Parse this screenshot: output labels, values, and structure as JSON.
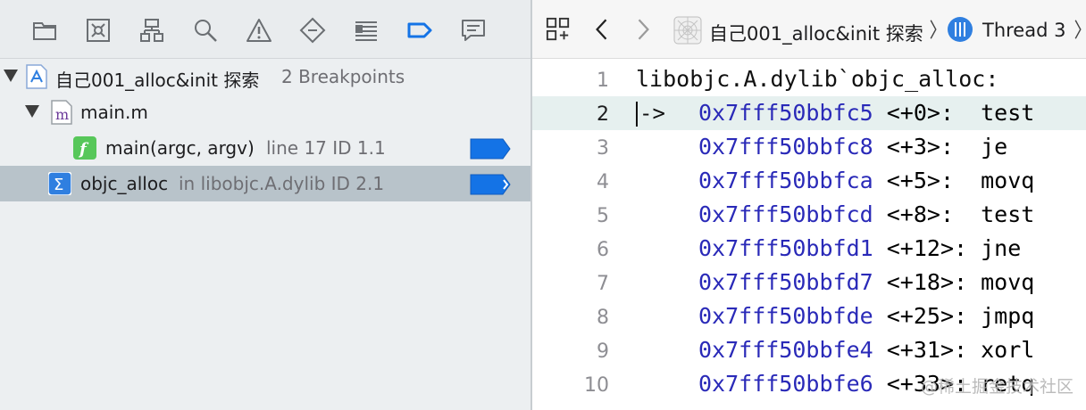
{
  "navigator": {
    "toolbar_icons": [
      "folder-icon",
      "source-control-icon",
      "hierarchy-icon",
      "search-icon",
      "warning-icon",
      "test-diamond-icon",
      "debug-list-icon",
      "breakpoint-icon",
      "report-icon"
    ],
    "active_tab": "breakpoint-icon",
    "project": {
      "name": "自己001_alloc&init 探索",
      "count": "2 Breakpoints"
    },
    "file": {
      "name": "main.m",
      "icon_letter": "m"
    },
    "breakpoints": [
      {
        "symbol": "main(argc, argv)",
        "detail": "line 17 ID 1.1",
        "icon_letter": "f",
        "icon_color": "#57c75a"
      },
      {
        "symbol": "objc_alloc",
        "detail": "in libobjc.A.dylib ID 2.1",
        "icon_letter": "Σ",
        "icon_color": "#2f7fe0"
      }
    ],
    "breakpoint_color": "#1473e6"
  },
  "jumpbar": {
    "project": "自己001_alloc&init 探索",
    "thread": "Thread 3"
  },
  "code": {
    "header": "libobjc.A.dylib`objc_alloc:",
    "current_marker": "->",
    "lines": [
      {
        "num": "1"
      },
      {
        "num": "2",
        "addr": "0x7fff50bbfc5",
        "off": "<+0>:",
        "op": "  test"
      },
      {
        "num": "3",
        "addr": "0x7fff50bbfc8",
        "off": "<+3>:",
        "op": "  je"
      },
      {
        "num": "4",
        "addr": "0x7fff50bbfca",
        "off": "<+5>:",
        "op": "  movq"
      },
      {
        "num": "5",
        "addr": "0x7fff50bbfcd",
        "off": "<+8>:",
        "op": "  test"
      },
      {
        "num": "6",
        "addr": "0x7fff50bbfd1",
        "off": "<+12>:",
        "op": " jne"
      },
      {
        "num": "7",
        "addr": "0x7fff50bbfd7",
        "off": "<+18>:",
        "op": " movq"
      },
      {
        "num": "8",
        "addr": "0x7fff50bbfde",
        "off": "<+25>:",
        "op": " jmpq"
      },
      {
        "num": "9",
        "addr": "0x7fff50bbfe4",
        "off": "<+31>:",
        "op": " xorl"
      },
      {
        "num": "10",
        "addr": "0x7fff50bbfe6",
        "off": "<+33>:",
        "op": " retq"
      }
    ]
  },
  "watermark": "@稀土掘金技术社区"
}
